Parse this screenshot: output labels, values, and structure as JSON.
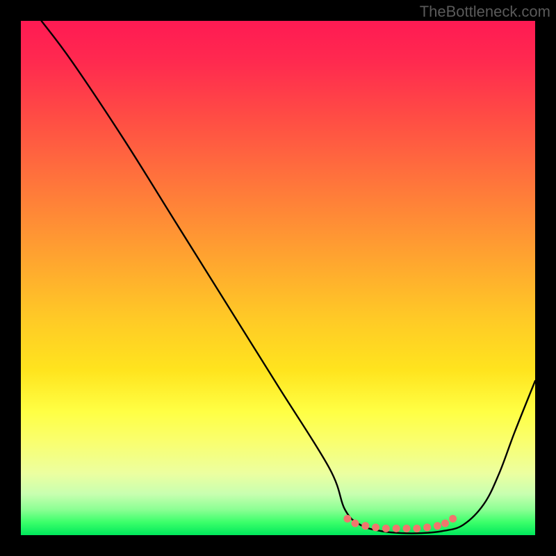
{
  "watermark": "TheBottleneck.com",
  "chart_data": {
    "type": "line",
    "title": "",
    "xlabel": "",
    "ylabel": "",
    "xlim": [
      0,
      100
    ],
    "ylim": [
      0,
      100
    ],
    "series": [
      {
        "name": "curve",
        "x": [
          4,
          10,
          20,
          30,
          40,
          50,
          60,
          63,
          66,
          70,
          74,
          78,
          82,
          86,
          90,
          93,
          96,
          100
        ],
        "y": [
          100,
          92,
          77,
          61,
          45,
          29,
          13,
          5,
          2,
          0.8,
          0.4,
          0.4,
          0.8,
          2,
          6,
          12,
          20,
          30
        ]
      }
    ],
    "markers": {
      "name": "plateau-dots",
      "color": "#f0766d",
      "points": [
        {
          "x": 63.5,
          "y": 3.2
        },
        {
          "x": 65.0,
          "y": 2.3
        },
        {
          "x": 67.0,
          "y": 1.8
        },
        {
          "x": 69.0,
          "y": 1.5
        },
        {
          "x": 71.0,
          "y": 1.3
        },
        {
          "x": 73.0,
          "y": 1.3
        },
        {
          "x": 75.0,
          "y": 1.3
        },
        {
          "x": 77.0,
          "y": 1.3
        },
        {
          "x": 79.0,
          "y": 1.5
        },
        {
          "x": 81.0,
          "y": 1.8
        },
        {
          "x": 82.5,
          "y": 2.3
        },
        {
          "x": 84.0,
          "y": 3.2
        }
      ]
    },
    "gradient_stops": [
      {
        "pos": 0.0,
        "color": "#ff1a53"
      },
      {
        "pos": 0.5,
        "color": "#ffca26"
      },
      {
        "pos": 0.8,
        "color": "#ffff50"
      },
      {
        "pos": 1.0,
        "color": "#00e85c"
      }
    ]
  }
}
